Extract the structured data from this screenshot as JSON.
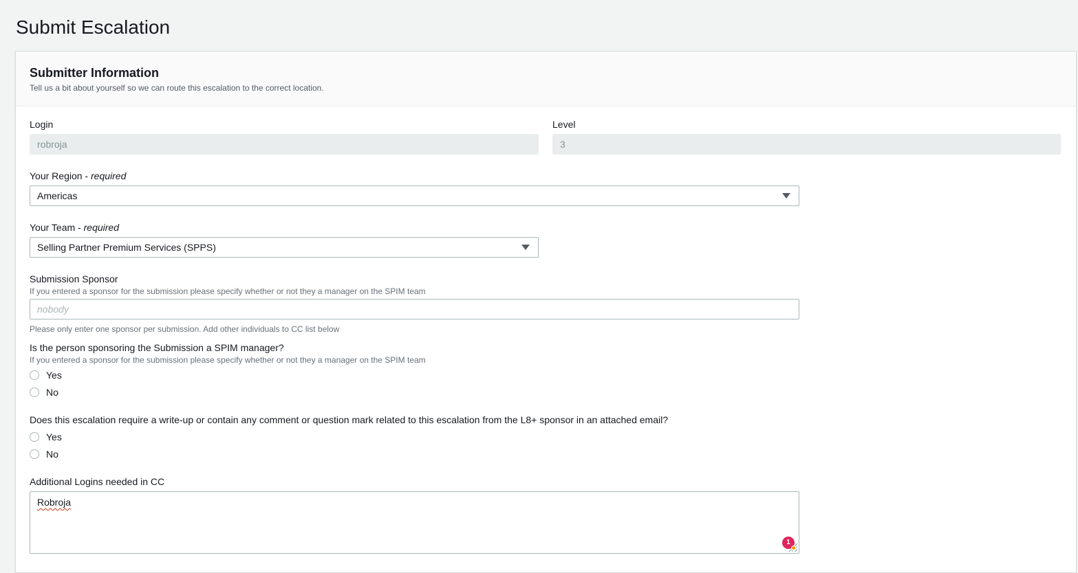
{
  "page": {
    "title": "Submit Escalation"
  },
  "section": {
    "title": "Submitter Information",
    "description": "Tell us a bit about yourself so we can route this escalation to the correct location."
  },
  "login": {
    "label": "Login",
    "value": "robroja"
  },
  "level": {
    "label": "Level",
    "value": "3"
  },
  "region": {
    "label": "Your Region",
    "required": "required",
    "value": "Americas"
  },
  "team": {
    "label": "Your Team",
    "required": "required",
    "value": "Selling Partner Premium Services (SPPS)"
  },
  "sponsor": {
    "label": "Submission Sponsor",
    "description": "If you entered a sponsor for the submission please specify whether or not they a manager on the SPIM team",
    "placeholder": "nobody",
    "constraint": "Please only enter one sponsor per submission. Add other individuals to CC list below"
  },
  "spim_manager": {
    "label": "Is the person sponsoring the Submission a SPIM manager?",
    "description": "If you entered a sponsor for the submission please specify whether or not they a manager on the SPIM team",
    "options": [
      "Yes",
      "No"
    ]
  },
  "writeup": {
    "label": "Does this escalation require a write-up or contain any comment or question mark related to this escalation from the L8+ sponsor in an attached email?",
    "options": [
      "Yes",
      "No"
    ]
  },
  "cc": {
    "label": "Additional Logins needed in CC",
    "value": "Robroja",
    "badge_count": "1"
  },
  "colors": {
    "background": "#f2f3f3",
    "panel": "#ffffff",
    "badge": "#e0245e",
    "spellcheck": "#d13212"
  }
}
